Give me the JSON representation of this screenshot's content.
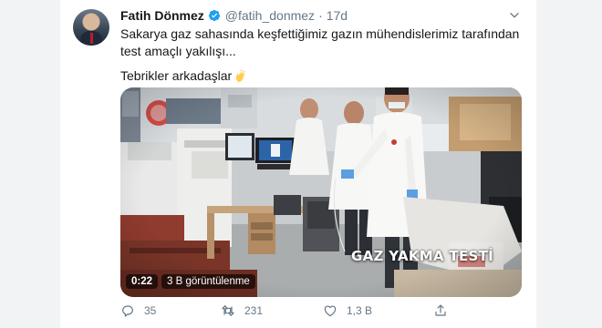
{
  "tweet": {
    "author_name": "Fatih Dönmez",
    "handle": "@fatih_donmez",
    "separator": "·",
    "time": "17d",
    "text_line1": "Sakarya gaz sahasında keşfettiğimiz gazın mühendislerimiz tarafından test amaçlı yakılışı...",
    "text_line2": "Tebrikler arkadaşlar",
    "emoji": "clapping-hands-icon"
  },
  "media": {
    "overlay_title": "GAZ YAKMA TESTİ",
    "duration": "0:22",
    "views": "3 B görüntülenme"
  },
  "actions": {
    "reply_count": "35",
    "retweet_count": "231",
    "like_count": "1,3 B",
    "reply_icon": "reply-icon",
    "retweet_icon": "retweet-icon",
    "like_icon": "heart-icon",
    "share_icon": "share-icon"
  },
  "colors": {
    "verified": "#1da1f2",
    "muted": "#657786",
    "text": "#14171a"
  }
}
